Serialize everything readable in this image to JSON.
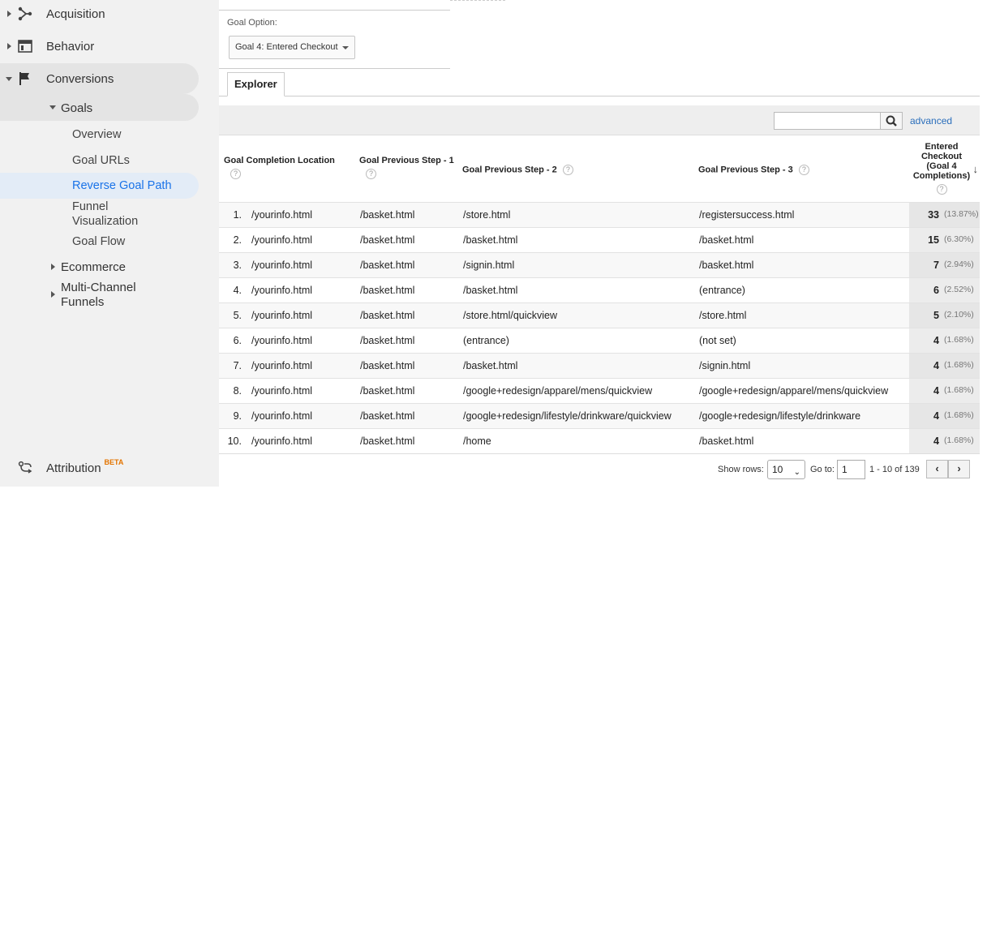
{
  "sidebar": {
    "acquisition": "Acquisition",
    "behavior": "Behavior",
    "conversions": "Conversions",
    "goals": "Goals",
    "overview": "Overview",
    "goal_urls": "Goal URLs",
    "reverse_goal_path": "Reverse Goal Path",
    "funnel_line1": "Funnel",
    "funnel_line2": "Visualization",
    "goal_flow": "Goal Flow",
    "ecommerce": "Ecommerce",
    "multichannel_line1": "Multi-Channel",
    "multichannel_line2": "Funnels",
    "attribution": "Attribution",
    "attribution_badge": "BETA"
  },
  "goal": {
    "option_label": "Goal Option:",
    "selected": "Goal 4: Entered Checkout"
  },
  "tabs": {
    "explorer": "Explorer"
  },
  "toolbar": {
    "advanced": "advanced"
  },
  "table": {
    "headers": {
      "col1": "Goal Completion Location",
      "col2": "Goal Previous Step - 1",
      "col3": "Goal Previous Step - 2",
      "col4": "Goal Previous Step - 3",
      "metric": "Entered Checkout (Goal 4 Completions)"
    },
    "rows": [
      {
        "n": "1.",
        "c1": "/yourinfo.html",
        "c2": "/basket.html",
        "c3": "/store.html",
        "c4": "/registersuccess.html",
        "v": "33",
        "p": "(13.87%)"
      },
      {
        "n": "2.",
        "c1": "/yourinfo.html",
        "c2": "/basket.html",
        "c3": "/basket.html",
        "c4": "/basket.html",
        "v": "15",
        "p": "(6.30%)"
      },
      {
        "n": "3.",
        "c1": "/yourinfo.html",
        "c2": "/basket.html",
        "c3": "/signin.html",
        "c4": "/basket.html",
        "v": "7",
        "p": "(2.94%)"
      },
      {
        "n": "4.",
        "c1": "/yourinfo.html",
        "c2": "/basket.html",
        "c3": "/basket.html",
        "c4": "(entrance)",
        "v": "6",
        "p": "(2.52%)"
      },
      {
        "n": "5.",
        "c1": "/yourinfo.html",
        "c2": "/basket.html",
        "c3": "/store.html/quickview",
        "c4": "/store.html",
        "v": "5",
        "p": "(2.10%)"
      },
      {
        "n": "6.",
        "c1": "/yourinfo.html",
        "c2": "/basket.html",
        "c3": "(entrance)",
        "c4": "(not set)",
        "v": "4",
        "p": "(1.68%)"
      },
      {
        "n": "7.",
        "c1": "/yourinfo.html",
        "c2": "/basket.html",
        "c3": "/basket.html",
        "c4": "/signin.html",
        "v": "4",
        "p": "(1.68%)"
      },
      {
        "n": "8.",
        "c1": "/yourinfo.html",
        "c2": "/basket.html",
        "c3": "/google+redesign/apparel/mens/quickview",
        "c4": "/google+redesign/apparel/mens/quickview",
        "v": "4",
        "p": "(1.68%)"
      },
      {
        "n": "9.",
        "c1": "/yourinfo.html",
        "c2": "/basket.html",
        "c3": "/google+redesign/lifestyle/drinkware/quickview",
        "c4": "/google+redesign/lifestyle/drinkware",
        "v": "4",
        "p": "(1.68%)"
      },
      {
        "n": "10.",
        "c1": "/yourinfo.html",
        "c2": "/basket.html",
        "c3": "/home",
        "c4": "/basket.html",
        "v": "4",
        "p": "(1.68%)"
      }
    ]
  },
  "pagination": {
    "show_rows_label": "Show rows:",
    "rows_value": "10",
    "goto_label": "Go to:",
    "goto_value": "1",
    "range": "1 - 10 of 139"
  }
}
